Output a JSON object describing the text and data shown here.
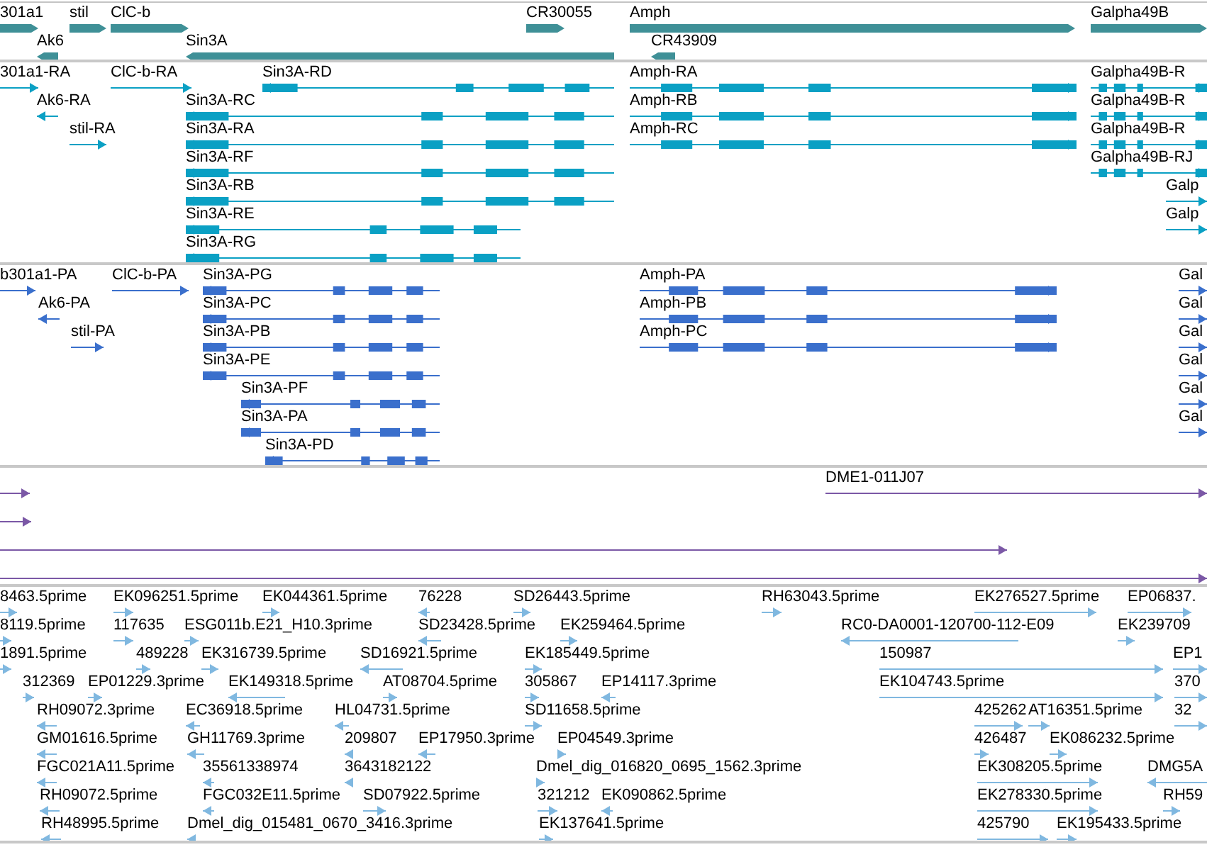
{
  "tracks": [
    {
      "kind": "gene",
      "color": "#3f9097",
      "features": [
        {
          "label": "301a1",
          "forward": true
        },
        {
          "label": "stil",
          "forward": true
        },
        {
          "label": "ClC-b",
          "forward": true
        },
        {
          "label": "CR30055",
          "forward": true
        },
        {
          "label": "Amph",
          "forward": true
        },
        {
          "label": "Galpha49B",
          "forward": true
        },
        {
          "label": "Ak6",
          "forward": false
        },
        {
          "label": "Sin3A",
          "forward": false
        },
        {
          "label": "CR43909",
          "forward": false
        }
      ]
    },
    {
      "kind": "transcript",
      "color": "#0aa0c4",
      "features": [
        {
          "label": "301a1-RA",
          "forward": true
        },
        {
          "label": "ClC-b-RA",
          "forward": true
        },
        {
          "label": "Sin3A-RD",
          "forward": false
        },
        {
          "label": "Amph-RA",
          "forward": true
        },
        {
          "label": "Galpha49B-R",
          "forward": true
        },
        {
          "label": "Ak6-RA",
          "forward": false
        },
        {
          "label": "Sin3A-RC",
          "forward": false
        },
        {
          "label": "Amph-RB",
          "forward": true
        },
        {
          "label": "Galpha49B-R",
          "forward": true
        },
        {
          "label": "stil-RA",
          "forward": true
        },
        {
          "label": "Sin3A-RA",
          "forward": false
        },
        {
          "label": "Amph-RC",
          "forward": true
        },
        {
          "label": "Galpha49B-R",
          "forward": true
        },
        {
          "label": "Sin3A-RF",
          "forward": false
        },
        {
          "label": "Galpha49B-RJ",
          "forward": true
        },
        {
          "label": "Sin3A-RB",
          "forward": false
        },
        {
          "label": "Galp",
          "forward": true
        },
        {
          "label": "Sin3A-RE",
          "forward": false
        },
        {
          "label": "Galp",
          "forward": true
        },
        {
          "label": "Sin3A-RG",
          "forward": false
        }
      ]
    },
    {
      "kind": "transcript",
      "color": "#3a6fcc",
      "features": [
        {
          "label": "b301a1-PA",
          "forward": true
        },
        {
          "label": "ClC-b-PA",
          "forward": true
        },
        {
          "label": "Sin3A-PG",
          "forward": false
        },
        {
          "label": "Amph-PA",
          "forward": true
        },
        {
          "label": "Gal",
          "forward": true
        },
        {
          "label": "Ak6-PA",
          "forward": false
        },
        {
          "label": "Sin3A-PC",
          "forward": false
        },
        {
          "label": "Amph-PB",
          "forward": true
        },
        {
          "label": "Gal",
          "forward": true
        },
        {
          "label": "stil-PA",
          "forward": true
        },
        {
          "label": "Sin3A-PB",
          "forward": false
        },
        {
          "label": "Amph-PC",
          "forward": true
        },
        {
          "label": "Gal",
          "forward": true
        },
        {
          "label": "Sin3A-PE",
          "forward": false
        },
        {
          "label": "Gal",
          "forward": true
        },
        {
          "label": "Sin3A-PF",
          "forward": false
        },
        {
          "label": "Gal",
          "forward": true
        },
        {
          "label": "Sin3A-PA",
          "forward": false
        },
        {
          "label": "Gal",
          "forward": true
        },
        {
          "label": "Sin3A-PD",
          "forward": false
        }
      ]
    },
    {
      "kind": "alignment",
      "color": "#7b58a6",
      "features": [
        {
          "label": "DME1-011J07",
          "forward": true
        },
        {
          "forward": true
        },
        {
          "forward": true
        },
        {
          "forward": true
        },
        {
          "forward": true
        }
      ]
    },
    {
      "kind": "alignment",
      "color": "#80b8e0",
      "features": [
        {
          "label": "8463.5prime",
          "forward": true
        },
        {
          "label": "EK096251.5prime",
          "forward": true
        },
        {
          "label": "EK044361.5prime",
          "forward": true
        },
        {
          "label": "76228",
          "forward": false
        },
        {
          "label": "SD26443.5prime",
          "forward": true
        },
        {
          "label": "RH63043.5prime",
          "forward": true
        },
        {
          "label": "EK276527.5prime",
          "forward": true
        },
        {
          "label": "EP06837.",
          "forward": true
        },
        {
          "label": "8119.5prime",
          "forward": true
        },
        {
          "label": "117635",
          "forward": true
        },
        {
          "label": "ESG011b.E21_H10.3prime",
          "forward": true
        },
        {
          "label": "SD23428.5prime",
          "forward": false
        },
        {
          "label": "EK259464.5prime",
          "forward": true
        },
        {
          "label": "RC0-DA0001-120700-112-E09",
          "forward": false
        },
        {
          "label": "EK239709",
          "forward": true
        },
        {
          "label": "1891.5prime",
          "forward": true
        },
        {
          "label": "489228",
          "forward": true
        },
        {
          "label": "EK316739.5prime",
          "forward": true
        },
        {
          "label": "SD16921.5prime",
          "forward": false
        },
        {
          "label": "EK185449.5prime",
          "forward": true
        },
        {
          "label": "150987",
          "forward": true
        },
        {
          "label": "EP1",
          "forward": true
        },
        {
          "label": "312369",
          "forward": true
        },
        {
          "label": "EP01229.3prime",
          "forward": true
        },
        {
          "label": "EK149318.5prime",
          "forward": false
        },
        {
          "label": "AT08704.5prime",
          "forward": true
        },
        {
          "label": "305867",
          "forward": true
        },
        {
          "label": "EP14117.3prime",
          "forward": false
        },
        {
          "label": "EK104743.5prime",
          "forward": true
        },
        {
          "label": "370",
          "forward": true
        },
        {
          "label": "RH09072.3prime",
          "forward": false
        },
        {
          "label": "EC36918.5prime",
          "forward": false
        },
        {
          "label": "HL04731.5prime",
          "forward": false
        },
        {
          "label": "SD11658.5prime",
          "forward": true
        },
        {
          "label": "425262",
          "forward": true
        },
        {
          "label": "AT16351.5prime",
          "forward": true
        },
        {
          "label": "32",
          "forward": true
        },
        {
          "label": "GM01616.5prime",
          "forward": false
        },
        {
          "label": "GH11769.3prime",
          "forward": false
        },
        {
          "label": "209807",
          "forward": false
        },
        {
          "label": "EP17950.3prime",
          "forward": false
        },
        {
          "label": "EP04549.3prime",
          "forward": true
        },
        {
          "label": "426487",
          "forward": true
        },
        {
          "label": "EK086232.5prime",
          "forward": true
        },
        {
          "label": "FGC021A11.5prime",
          "forward": false
        },
        {
          "label": "35561338974",
          "forward": false
        },
        {
          "label": "3643182122",
          "forward": false
        },
        {
          "label": "Dmel_dig_016820_0695_1562.3prime",
          "forward": true
        },
        {
          "label": "EK308205.5prime",
          "forward": true
        },
        {
          "label": "DMG5A",
          "forward": false
        },
        {
          "label": "RH09072.5prime",
          "forward": false
        },
        {
          "label": "FGC032E11.5prime",
          "forward": false
        },
        {
          "label": "SD07922.5prime",
          "forward": true
        },
        {
          "label": "321212",
          "forward": true
        },
        {
          "label": "EK090862.5prime",
          "forward": false
        },
        {
          "label": "EK278330.5prime",
          "forward": true
        },
        {
          "label": "RH59",
          "forward": true
        },
        {
          "label": "RH48995.5prime",
          "forward": false
        },
        {
          "label": "Dmel_dig_015481_0670_3416.3prime",
          "forward": false
        },
        {
          "label": "EK137641.5prime",
          "forward": true
        },
        {
          "label": "425790",
          "forward": true
        },
        {
          "label": "EK195433.5prime",
          "forward": true
        }
      ]
    }
  ]
}
